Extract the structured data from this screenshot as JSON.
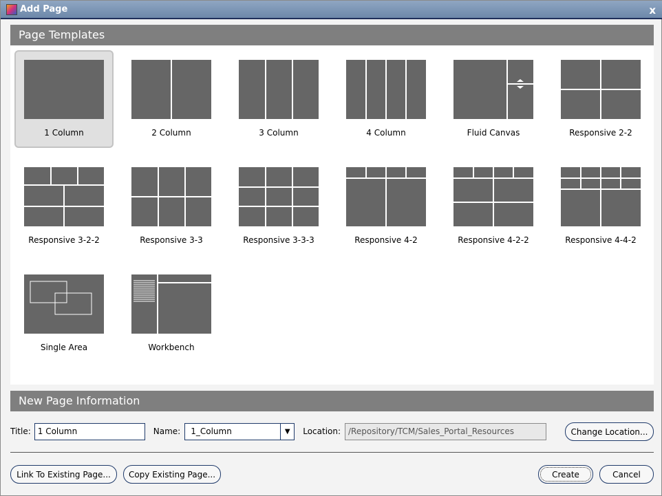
{
  "window": {
    "title": "Add Page",
    "close": "x"
  },
  "templates_header": "Page Templates",
  "templates": [
    {
      "label": "1 Column",
      "selected": true
    },
    {
      "label": "2 Column"
    },
    {
      "label": "3 Column"
    },
    {
      "label": "4 Column"
    },
    {
      "label": "Fluid Canvas"
    },
    {
      "label": "Responsive 2-2"
    },
    {
      "label": "Responsive 3-2-2"
    },
    {
      "label": "Responsive 3-3"
    },
    {
      "label": "Responsive 3-3-3"
    },
    {
      "label": "Responsive 4-2"
    },
    {
      "label": "Responsive 4-2-2"
    },
    {
      "label": "Responsive 4-4-2"
    },
    {
      "label": "Single Area"
    },
    {
      "label": "Workbench"
    }
  ],
  "info_header": "New Page Information",
  "form": {
    "title_label": "Title:",
    "title_value": "1 Column",
    "name_label": "Name:",
    "name_value": "1_Column",
    "location_label": "Location:",
    "location_value": "/Repository/TCM/Sales_Portal_Resources",
    "change_location": "Change Location..."
  },
  "buttons": {
    "link": "Link To Existing Page...",
    "copy": "Copy Existing Page...",
    "create": "Create",
    "cancel": "Cancel"
  }
}
